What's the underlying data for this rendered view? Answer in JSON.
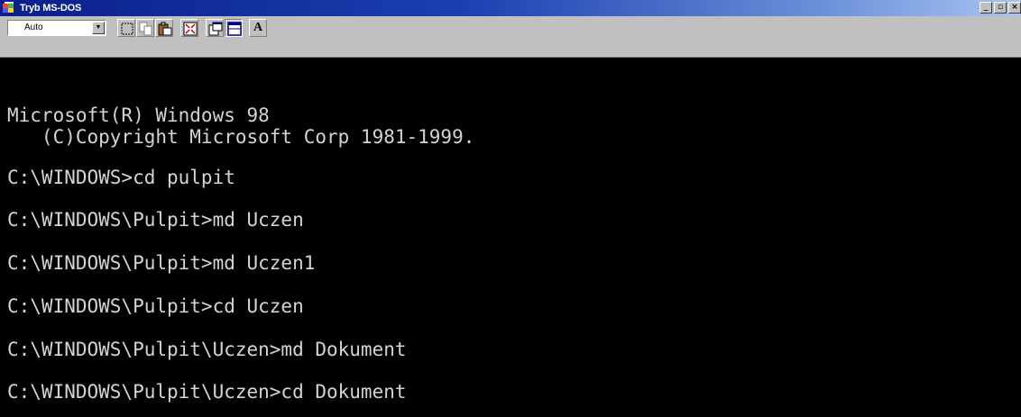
{
  "window": {
    "title": "Tryb MS-DOS",
    "minimize_glyph": "_",
    "maximize_glyph": "▫",
    "close_glyph": "×"
  },
  "toolbar": {
    "font_size_value": "Auto",
    "font_button_label": "A",
    "icons": [
      "mark-icon",
      "copy-icon",
      "paste-icon",
      "fullscreen-icon",
      "properties-icon",
      "background-icon",
      "font-icon"
    ]
  },
  "console": {
    "text_color": "#d4d4d4",
    "background_color": "#000000",
    "lines": [
      "Microsoft(R) Windows 98",
      "   (C)Copyright Microsoft Corp 1981-1999.",
      "C:\\WINDOWS>cd pulpit",
      "C:\\WINDOWS\\Pulpit>md Uczen",
      "C:\\WINDOWS\\Pulpit>md Uczen1",
      "C:\\WINDOWS\\Pulpit>cd Uczen",
      "C:\\WINDOWS\\Pulpit\\Uczen>md Dokument",
      "C:\\WINDOWS\\Pulpit\\Uczen>cd Dokument"
    ]
  },
  "colors": {
    "titlebar_start": "#0a1f8a",
    "titlebar_end": "#a6c4f0",
    "chrome": "#c0c0c0"
  }
}
